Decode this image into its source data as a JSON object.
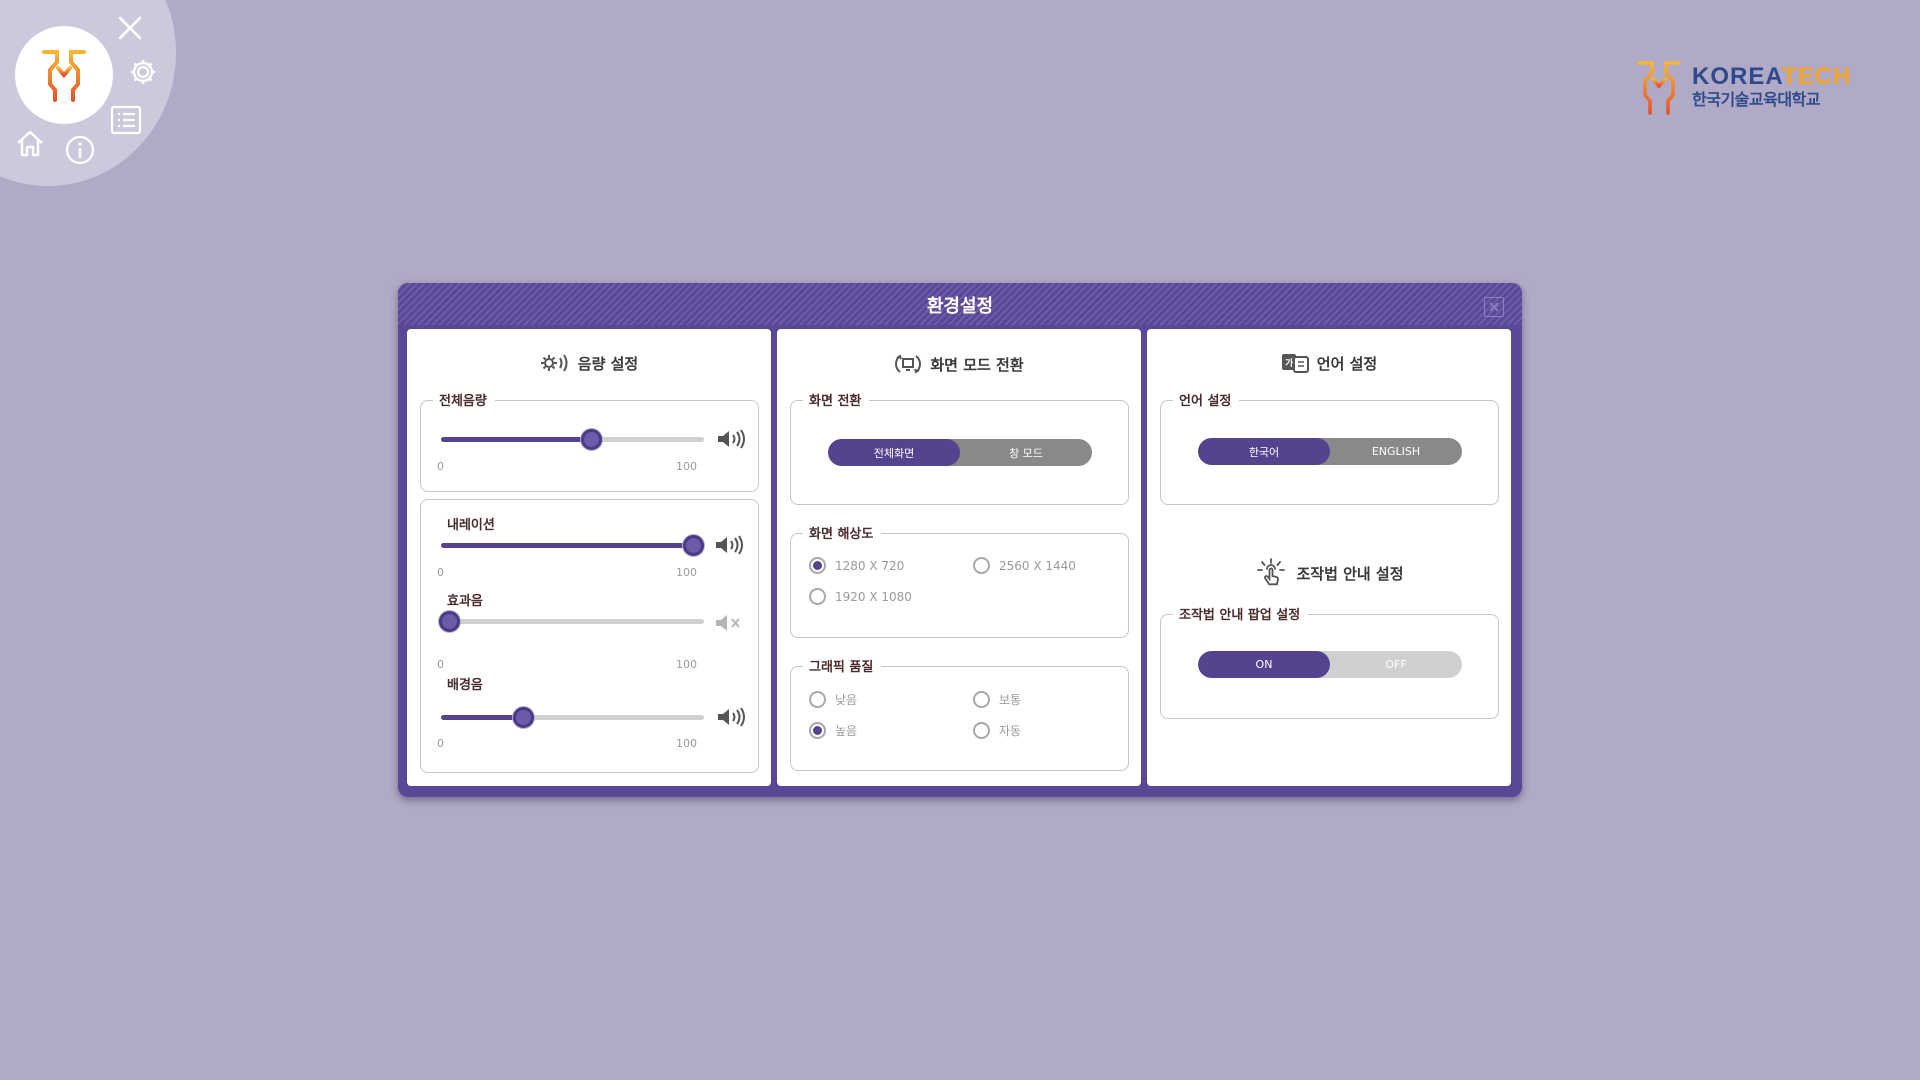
{
  "dialog": {
    "title": "환경설정",
    "volume": {
      "title": "음량 설정",
      "master": {
        "label": "전체음량",
        "min": "0",
        "max": "100",
        "value": 57,
        "muted": false
      },
      "narration": {
        "label": "내레이션",
        "min": "0",
        "max": "100",
        "value": 96,
        "muted": false
      },
      "effects": {
        "label": "효과음",
        "min": "0",
        "max": "100",
        "value": 3,
        "muted": true
      },
      "bgm": {
        "label": "배경음",
        "min": "0",
        "max": "100",
        "value": 31,
        "muted": false
      }
    },
    "screen": {
      "title": "화면 모드 전환",
      "mode": {
        "label": "화면 전환",
        "options": [
          "전체화면",
          "창 모드"
        ],
        "selected": 0
      },
      "resolution": {
        "label": "화면 해상도",
        "options": [
          "1280 X 720",
          "2560 X 1440",
          "1920 X 1080"
        ],
        "selected": 0
      },
      "quality": {
        "label": "그래픽 품질",
        "options": [
          "낮음",
          "보통",
          "높음",
          "자동"
        ],
        "selected": 2
      }
    },
    "language": {
      "title": "언어 설정",
      "setting": {
        "label": "언어 설정",
        "options": [
          "한국어",
          "ENGLISH"
        ],
        "selected": 0
      }
    },
    "guide": {
      "title": "조작법 안내 설정",
      "popup": {
        "label": "조작법 안내 팝업 설정",
        "options": [
          "ON",
          "OFF"
        ],
        "selected": 0
      }
    }
  },
  "brand": {
    "name_en_1": "KOREA",
    "name_en_2": "TECH",
    "name_ko": "한국기술교육대학교"
  },
  "colors": {
    "background": "#b0aac6",
    "accent": "#55438f",
    "dialog": "#5a4896",
    "brand_orange": "#f2a526",
    "brand_blue": "#2e4a8c"
  },
  "icons": [
    "close-icon",
    "gear-icon",
    "list-icon",
    "home-icon",
    "info-icon",
    "volume-icon",
    "mute-icon",
    "screen-mode-icon",
    "language-icon",
    "touch-guide-icon"
  ]
}
